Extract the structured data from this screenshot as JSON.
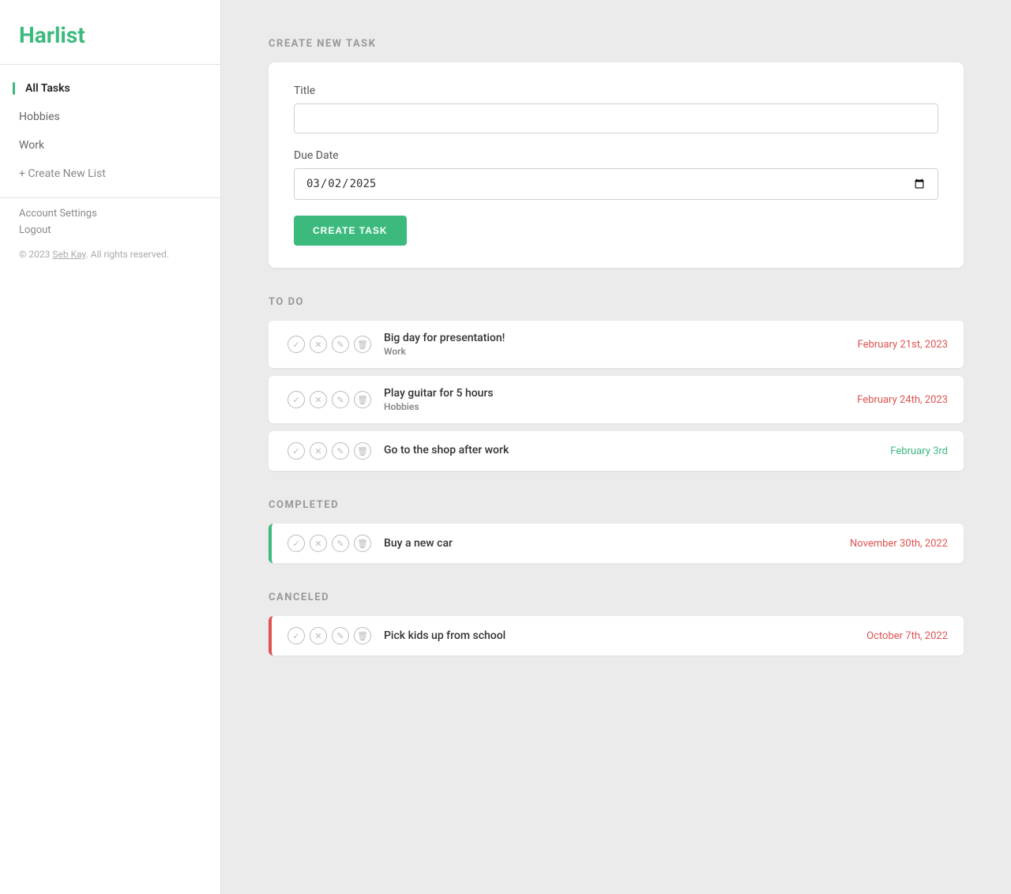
{
  "app": {
    "name": "Harlist"
  },
  "sidebar": {
    "nav_items": [
      {
        "id": "all-tasks",
        "label": "All Tasks",
        "active": true
      },
      {
        "id": "hobbies",
        "label": "Hobbies",
        "active": false
      },
      {
        "id": "work",
        "label": "Work",
        "active": false
      }
    ],
    "create_list_label": "+ Create New List",
    "account_settings_label": "Account Settings",
    "logout_label": "Logout",
    "copyright": "© 2023 ",
    "copyright_author": "Seb Kay",
    "copyright_suffix": ". All rights reserved."
  },
  "create_task": {
    "section_title": "CREATE NEW TASK",
    "title_label": "Title",
    "title_placeholder": "",
    "due_date_label": "Due Date",
    "due_date_value": "2025-03-02",
    "button_label": "CREATE TASK"
  },
  "todo": {
    "section_title": "TO DO",
    "tasks": [
      {
        "id": 1,
        "title": "Big day for presentation!",
        "list": "Work",
        "date": "February 21st, 2023",
        "date_class": "overdue"
      },
      {
        "id": 2,
        "title": "Play guitar for 5 hours",
        "list": "Hobbies",
        "date": "February 24th, 2023",
        "date_class": "overdue"
      },
      {
        "id": 3,
        "title": "Go to the shop after work",
        "list": "",
        "date": "February 3rd",
        "date_class": "upcoming"
      }
    ]
  },
  "completed": {
    "section_title": "COMPLETED",
    "tasks": [
      {
        "id": 4,
        "title": "Buy a new car",
        "list": "",
        "date": "November 30th, 2022",
        "date_class": "overdue"
      }
    ]
  },
  "canceled": {
    "section_title": "CANCELED",
    "tasks": [
      {
        "id": 5,
        "title": "Pick kids up from school",
        "list": "",
        "date": "October 7th, 2022",
        "date_class": "overdue"
      }
    ]
  },
  "icons": {
    "check": "✓",
    "cancel": "✕",
    "edit": "✎",
    "delete": "🗑"
  }
}
